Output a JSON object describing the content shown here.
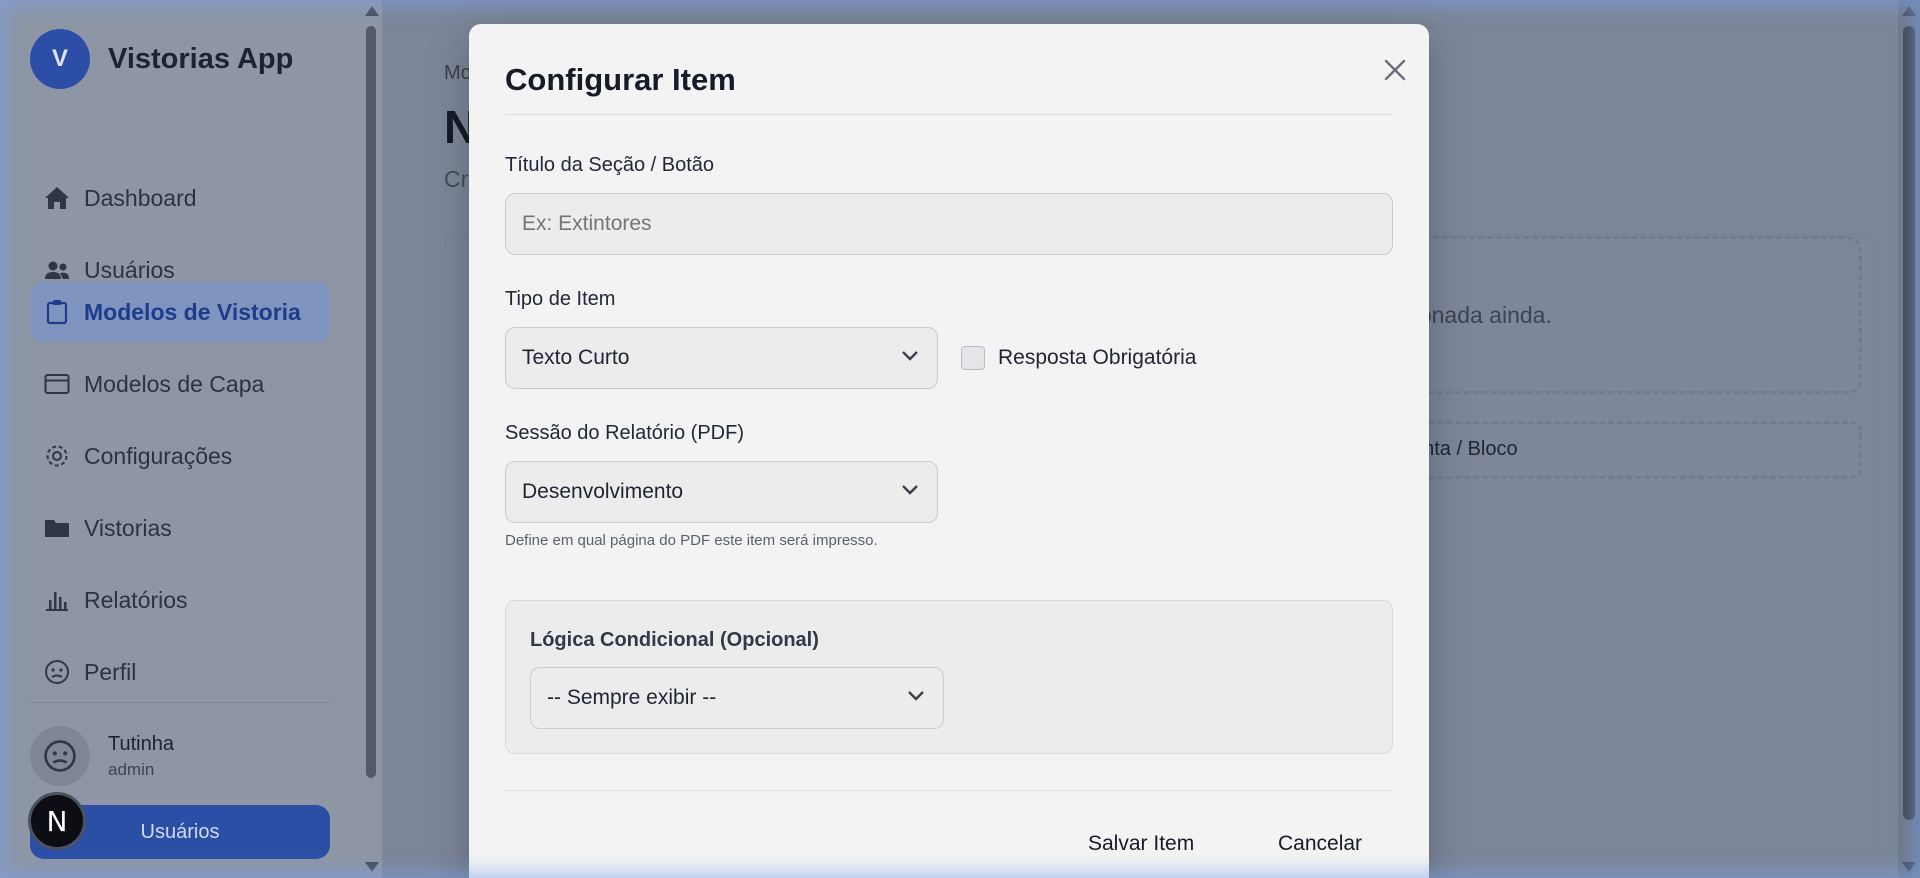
{
  "app": {
    "brand_initial": "V",
    "brand_title": "Vistorias App"
  },
  "sidebar": {
    "items": [
      {
        "label": "Dashboard",
        "icon": "home-icon"
      },
      {
        "label": "Usuários",
        "icon": "users-icon"
      },
      {
        "label": "Modelos de Vistoria",
        "icon": "clipboard-icon",
        "active": true
      },
      {
        "label": "Modelos de Capa",
        "icon": "card-icon"
      },
      {
        "label": "Configurações",
        "icon": "gear-icon"
      },
      {
        "label": "Vistorias",
        "icon": "folder-icon"
      },
      {
        "label": "Relatórios",
        "icon": "bar-chart-icon"
      },
      {
        "label": "Perfil",
        "icon": "face-icon"
      }
    ],
    "user": {
      "name": "Tutinha",
      "role": "admin"
    },
    "users_button": "Usuários",
    "next_badge": "N"
  },
  "main": {
    "breadcrumb": "Mo",
    "heading": "N",
    "subtitle": "Cr",
    "empty_text": "licionada ainda.",
    "add_text": "unta / Bloco"
  },
  "modal": {
    "title": "Configurar Item",
    "section_title_label": "Título da Seção / Botão",
    "section_title_placeholder": "Ex: Extintores",
    "item_type_label": "Tipo de Item",
    "item_type_value": "Texto Curto",
    "required_label": "Resposta Obrigatória",
    "report_section_label": "Sessão do Relatório (PDF)",
    "report_section_value": "Desenvolvimento",
    "report_section_help": "Define em qual página do PDF este item será impresso.",
    "conditional_title": "Lógica Condicional (Opcional)",
    "conditional_value": "-- Sempre exibir --",
    "save_label": "Salvar Item",
    "cancel_label": "Cancelar"
  },
  "colors": {
    "accent": "#2c4fa6",
    "modal_bg": "#f3f3f3",
    "overlay": "#7d8799"
  }
}
